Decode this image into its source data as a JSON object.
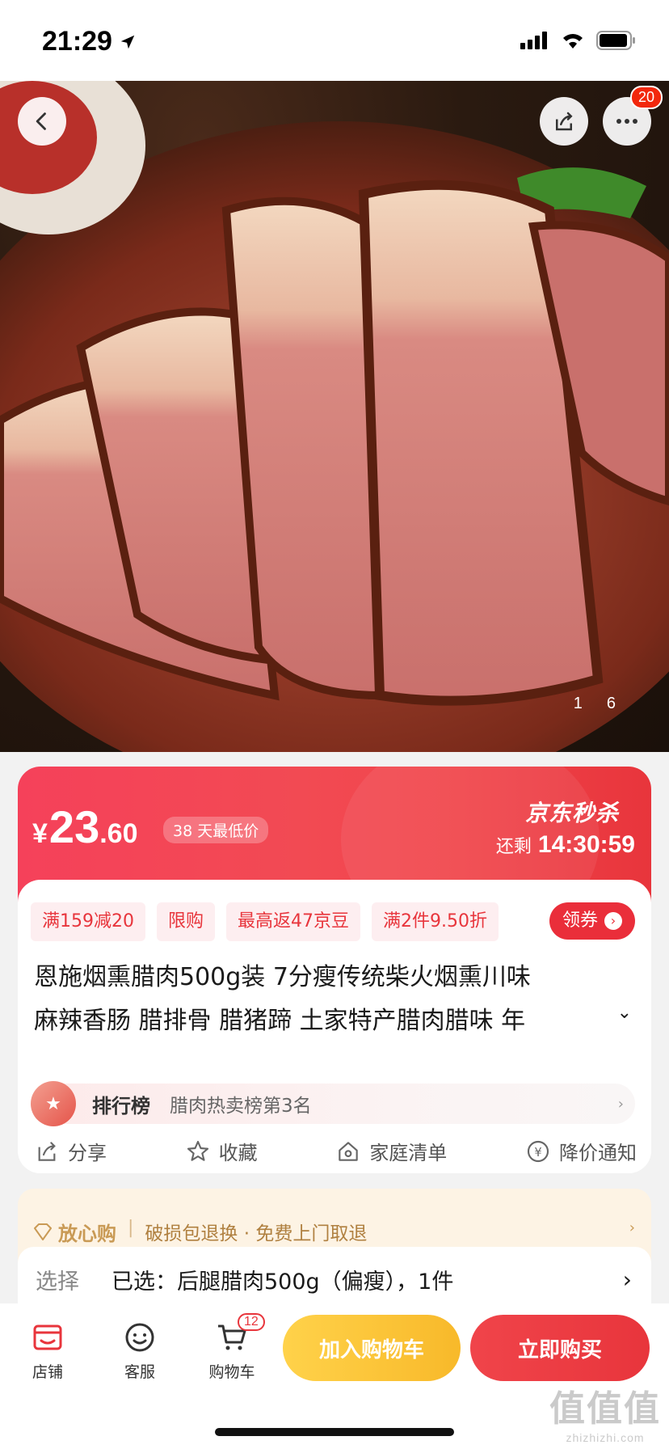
{
  "status_bar": {
    "time": "21:29"
  },
  "hero": {
    "cart_badge": "20",
    "page_current": "1",
    "page_total": "6"
  },
  "price": {
    "currency": "¥",
    "integer": "23",
    "decimal": ".60",
    "low_badge": "38 天最低价",
    "seckill_brand": "京东秒杀",
    "remain_label": "还剩",
    "remain_time": "14:30:59"
  },
  "coupons": [
    "满159减20",
    "限购",
    "最高返47京豆",
    "满2件9.50折"
  ],
  "coupon_button": "领券",
  "product": {
    "title_line1": "恩施烟熏腊肉500g装 7分瘦传统柴火烟熏川味",
    "title_line2": "麻辣香肠 腊排骨 腊猪蹄 土家特产腊肉腊味 年"
  },
  "rank": {
    "title": "排行榜",
    "desc": "腊肉热卖榜第3名"
  },
  "actions": {
    "share": "分享",
    "favorite": "收藏",
    "family_list": "家庭清单",
    "price_alert": "降价通知"
  },
  "guarantee": {
    "brand": "放心购",
    "text": "破损包退换 · 免费上门取退"
  },
  "selection": {
    "label": "选择",
    "value": "已选：后腿腊肉500g（偏瘦），1件"
  },
  "bottom_bar": {
    "store": "店铺",
    "service": "客服",
    "cart": "购物车",
    "cart_count": "12",
    "add_to_cart": "加入购物车",
    "buy_now": "立即购买"
  },
  "watermark": {
    "main": "值值值",
    "sub": "zhizhizhi.com"
  },
  "colors": {
    "accent_red": "#e8353c",
    "cart_yellow": "#f8b92a",
    "guarantee_gold": "#c99a55"
  }
}
